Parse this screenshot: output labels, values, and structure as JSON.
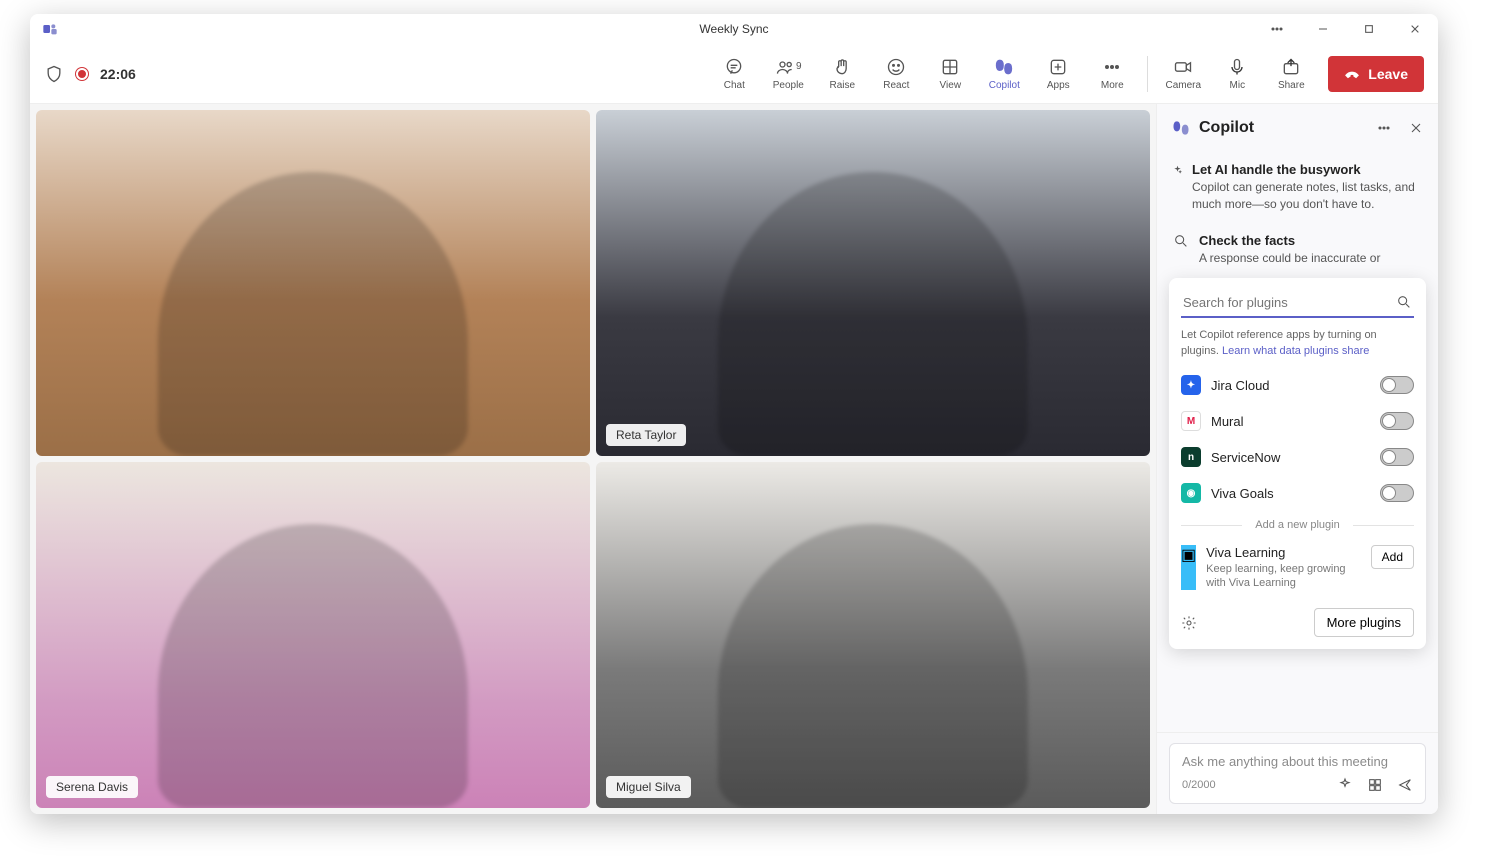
{
  "window": {
    "title": "Weekly Sync"
  },
  "recording": {
    "timer": "22:06"
  },
  "toolbar": {
    "chat": "Chat",
    "people": "People",
    "people_count": "9",
    "raise": "Raise",
    "react": "React",
    "view": "View",
    "copilot": "Copilot",
    "apps": "Apps",
    "more": "More",
    "camera": "Camera",
    "mic": "Mic",
    "share": "Share",
    "leave": "Leave"
  },
  "participants": [
    {
      "name": ""
    },
    {
      "name": "Reta Taylor"
    },
    {
      "name": "Serena Davis"
    },
    {
      "name": "Miguel Silva"
    }
  ],
  "copilot": {
    "title": "Copilot",
    "cards": [
      {
        "title": "Let AI handle the busywork",
        "desc": "Copilot can generate notes, list tasks, and much more—so you don't have to."
      },
      {
        "title": "Check the facts",
        "desc": "A response could be inaccurate or"
      }
    ],
    "search_placeholder": "Search for plugins",
    "help_text": "Let Copilot reference apps by turning on plugins.",
    "help_link": "Learn what data plugins share",
    "plugins": [
      {
        "name": "Jira Cloud",
        "icon": "jira"
      },
      {
        "name": "Mural",
        "icon": "mural"
      },
      {
        "name": "ServiceNow",
        "icon": "snow"
      },
      {
        "name": "Viva Goals",
        "icon": "viva"
      }
    ],
    "divider": "Add a new plugin",
    "new_plugin": {
      "name": "Viva Learning",
      "desc": "Keep learning, keep growing with Viva Learning",
      "add": "Add"
    },
    "more_plugins": "More plugins",
    "input_placeholder": "Ask me anything about this meeting",
    "counter": "0/2000"
  }
}
